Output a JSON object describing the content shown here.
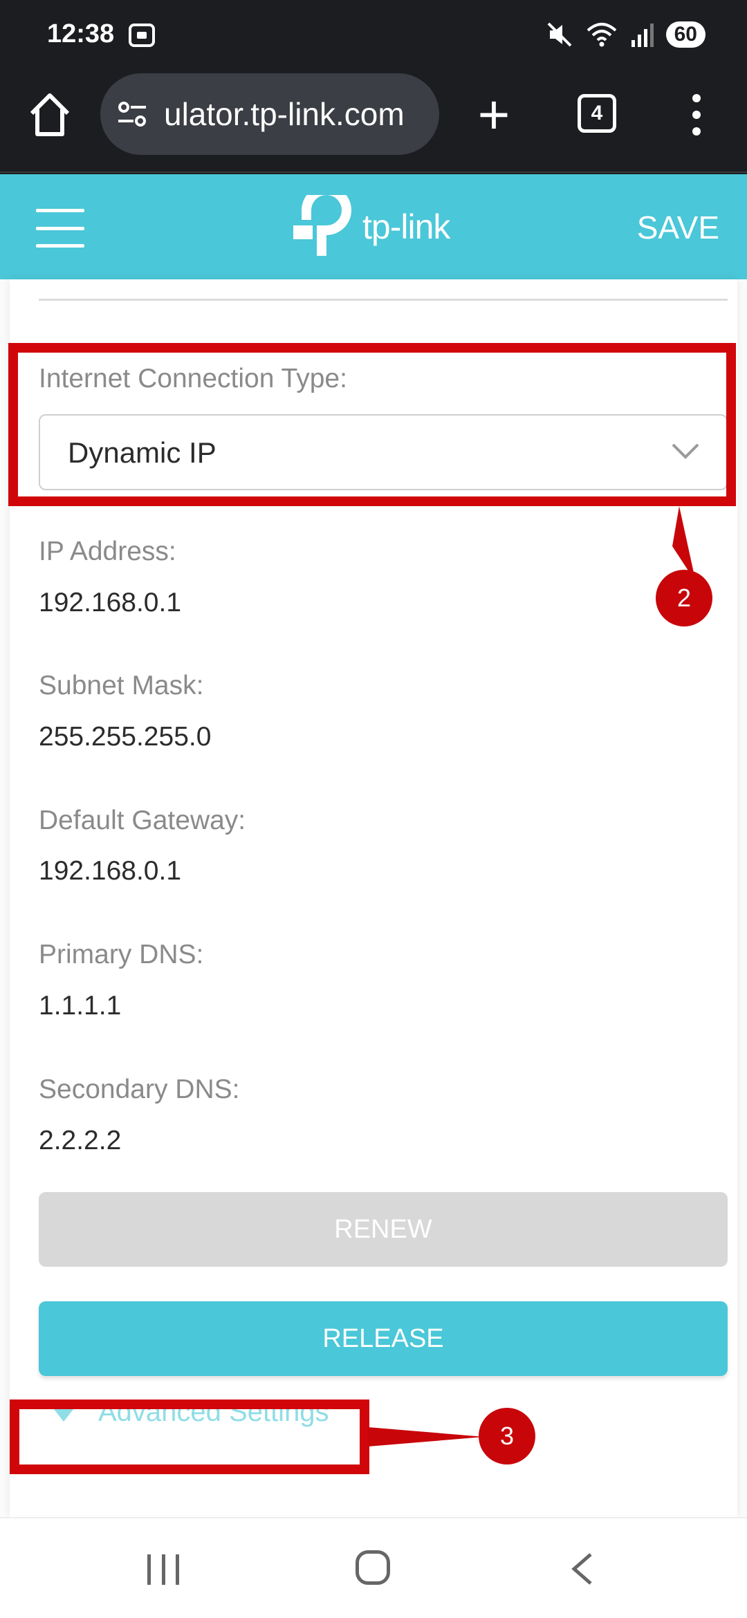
{
  "status_bar": {
    "time": "12:38",
    "battery": "60"
  },
  "browser": {
    "url": "ulator.tp-link.com",
    "tab_count": "4"
  },
  "header": {
    "logo_text": "tp-link",
    "save_label": "SAVE"
  },
  "form": {
    "connection_type_label": "Internet Connection Type:",
    "connection_type_value": "Dynamic IP",
    "fields": [
      {
        "label": "IP Address:",
        "value": "192.168.0.1"
      },
      {
        "label": "Subnet Mask:",
        "value": "255.255.255.0"
      },
      {
        "label": "Default Gateway:",
        "value": "192.168.0.1"
      },
      {
        "label": "Primary DNS:",
        "value": "1.1.1.1"
      },
      {
        "label": "Secondary DNS:",
        "value": "2.2.2.2"
      }
    ],
    "renew_label": "RENEW",
    "release_label": "RELEASE",
    "advanced_label": "Advanced Settings"
  },
  "annotations": {
    "badge_2": "2",
    "badge_3": "3",
    "color": "#d0060b"
  },
  "colors": {
    "accent": "#4ac7d8",
    "advanced_link": "#8fdde6"
  }
}
